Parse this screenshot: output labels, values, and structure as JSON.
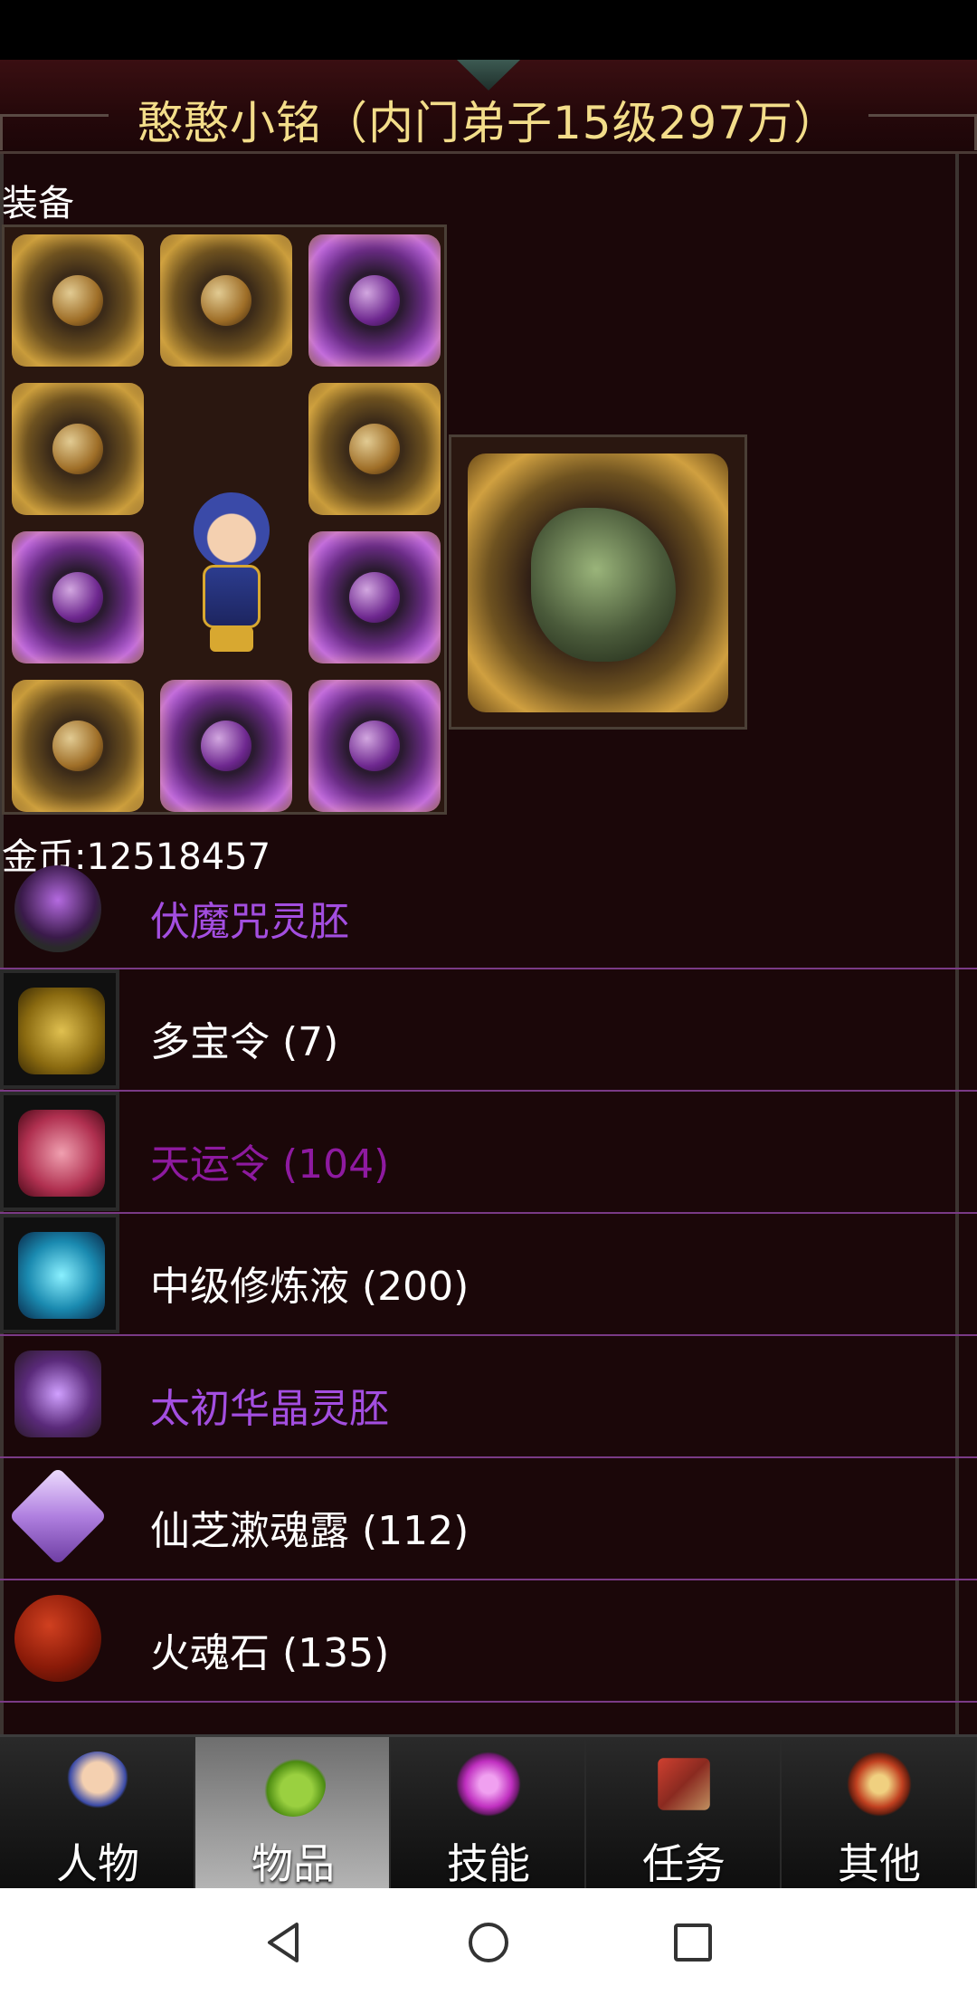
{
  "header": {
    "title": "憨憨小铭（内门弟子15级297万）"
  },
  "equipment": {
    "section_label": "装备",
    "slot_icons": [
      "helmet-icon",
      "armor-icon",
      "amulet-icon",
      "sword-icon",
      "blade-icon",
      "ring-icon",
      "ring-icon",
      "bracer-icon",
      "boots-icon",
      "orb-icon"
    ],
    "pet_icon": "dragon-icon"
  },
  "currency": {
    "gold_label": "金币:12518457"
  },
  "items": [
    {
      "name": "伏魔咒灵胚",
      "icon": "ring-icon",
      "color": "#a34ee0"
    },
    {
      "name": "多宝令 (7)",
      "icon": "token-icon",
      "color": "#ffffff"
    },
    {
      "name": "天运令 (104)",
      "icon": "token-icon",
      "color": "#8e1aa0"
    },
    {
      "name": "中级修炼液 (200)",
      "icon": "potion-icon",
      "color": "#ffffff"
    },
    {
      "name": "太初华晶灵胚",
      "icon": "crystal-icon",
      "color": "#a34ee0"
    },
    {
      "name": "仙芝漱魂露 (112)",
      "icon": "gem-flask-icon",
      "color": "#ffffff"
    },
    {
      "name": "火魂石 (135)",
      "icon": "fire-stone-icon",
      "color": "#ffffff"
    }
  ],
  "tabs": [
    {
      "label": "人物",
      "icon": "character-icon",
      "active": false
    },
    {
      "label": "物品",
      "icon": "potion-bag-icon",
      "active": true
    },
    {
      "label": "技能",
      "icon": "skill-orb-icon",
      "active": false
    },
    {
      "label": "任务",
      "icon": "quest-icon",
      "active": false
    },
    {
      "label": "其他",
      "icon": "settings-icon",
      "active": false
    }
  ],
  "system_nav": {
    "back": "back-icon",
    "home": "home-icon",
    "recents": "recents-icon"
  }
}
